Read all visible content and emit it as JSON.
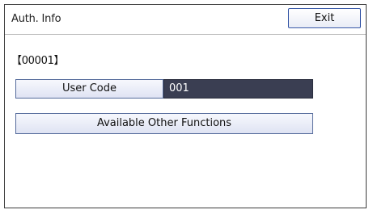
{
  "header": {
    "title": "Auth. Info",
    "exit_label": "Exit"
  },
  "record": {
    "id": "【00001】"
  },
  "user_code": {
    "label": "User Code",
    "value": "001"
  },
  "other_functions": {
    "label": "Available Other Functions"
  },
  "colors": {
    "value_background": "#3a3e52",
    "button_border": "#566c9c",
    "exit_border": "#3a5aa8"
  }
}
